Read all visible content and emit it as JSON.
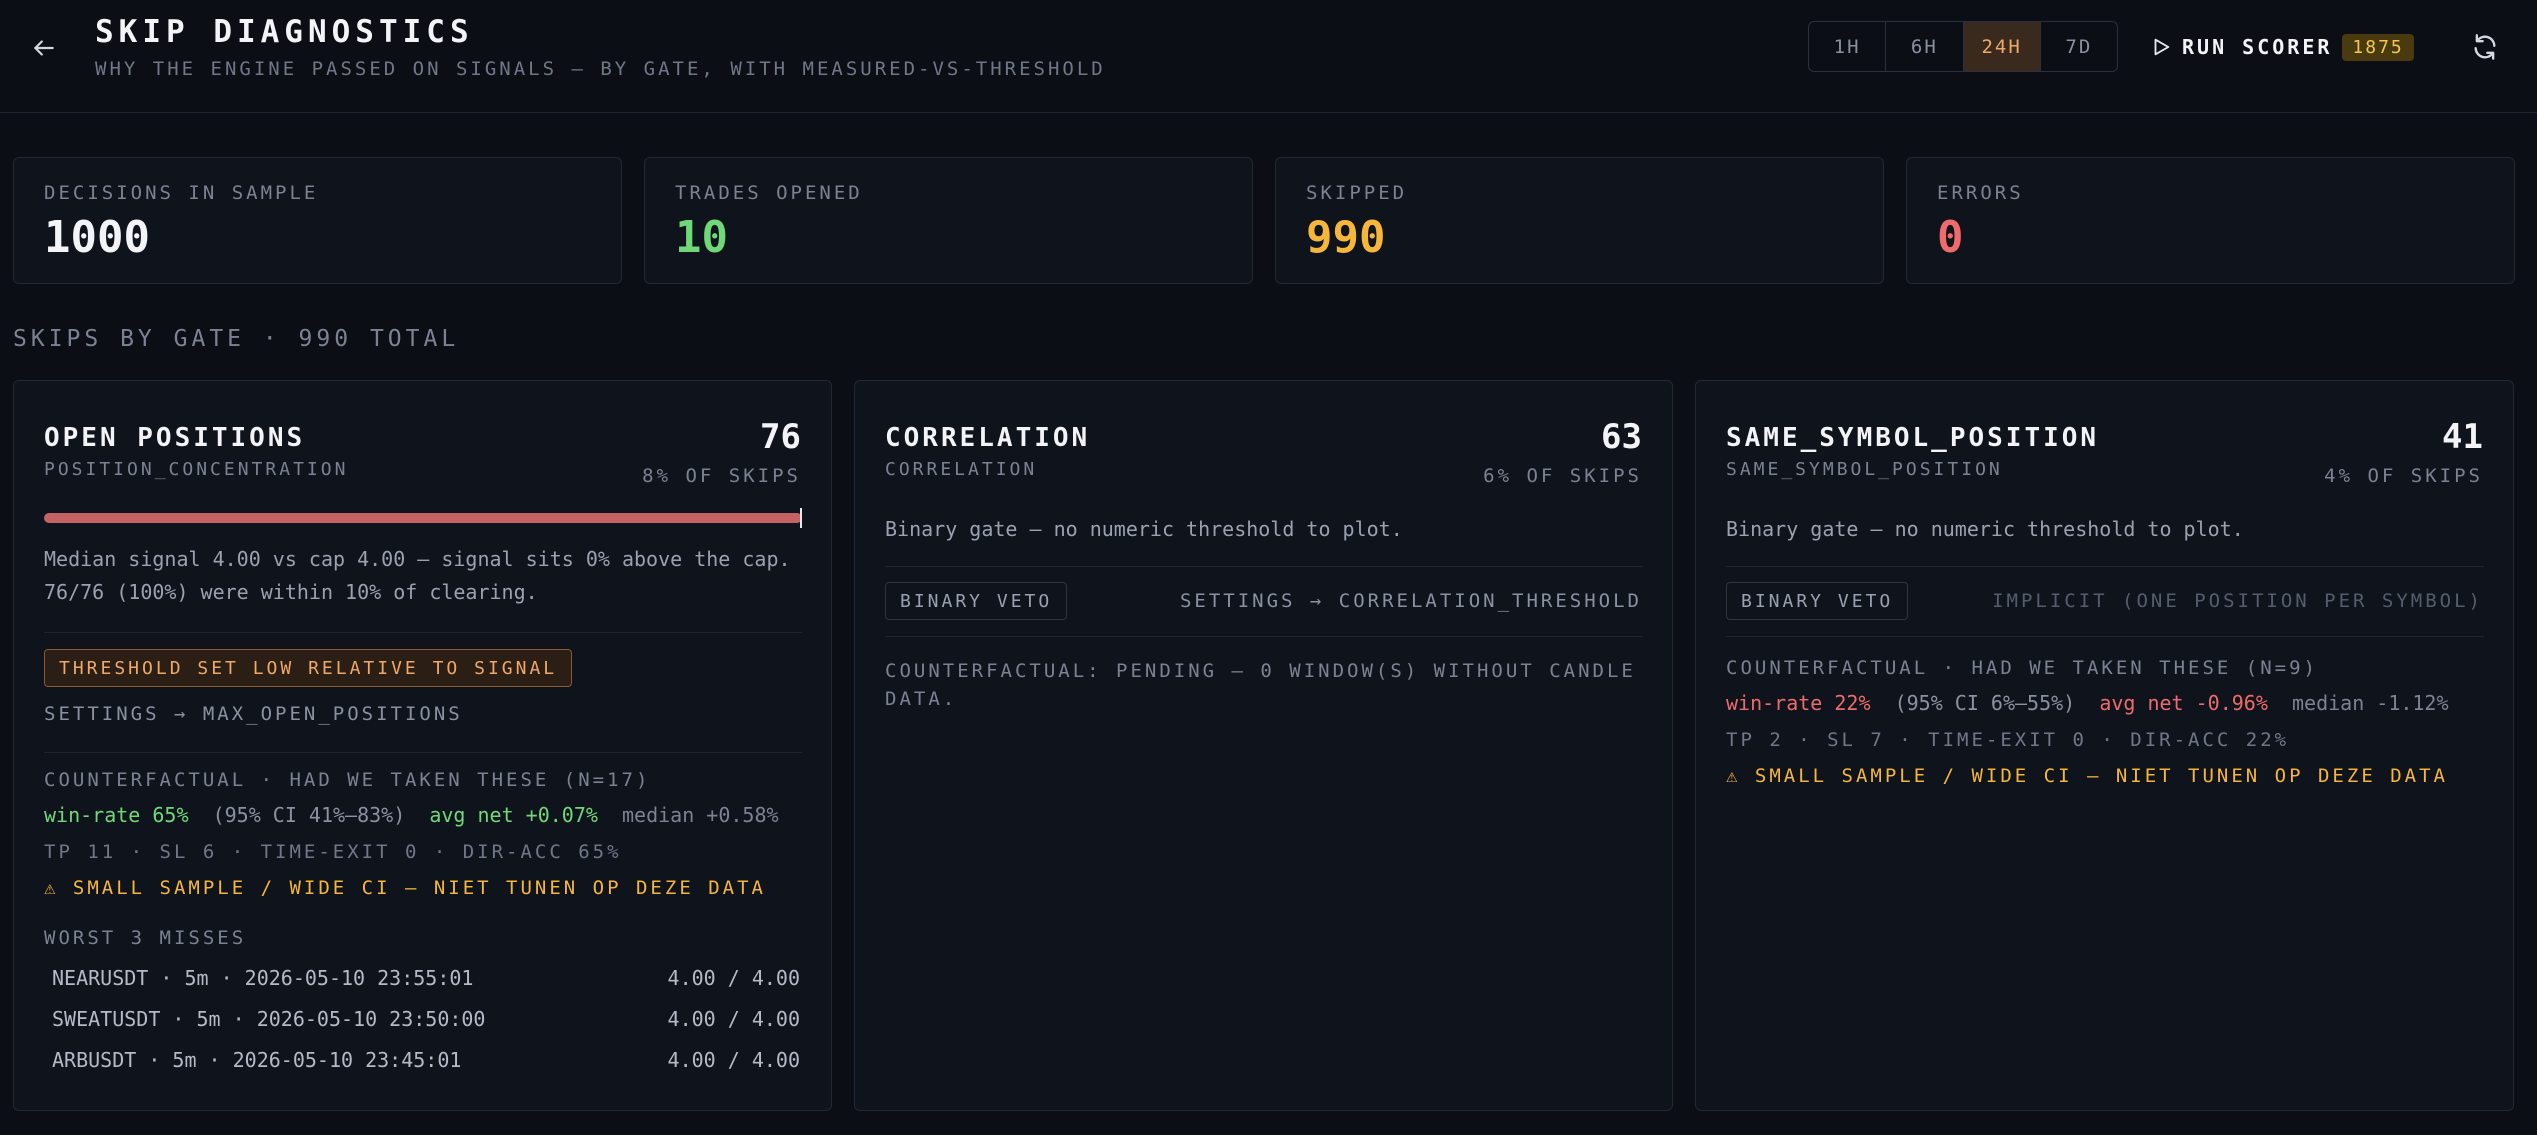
{
  "header": {
    "title": "SKIP DIAGNOSTICS",
    "subtitle": "WHY THE ENGINE PASSED ON SIGNALS — BY GATE, WITH MEASURED-VS-THRESHOLD",
    "ranges": [
      "1H",
      "6H",
      "24H",
      "7D"
    ],
    "active_range": "24H",
    "run_label": "RUN SCORER",
    "run_badge": "1875"
  },
  "stats": [
    {
      "label": "DECISIONS IN SAMPLE",
      "value": "1000",
      "color": "#f3f4f7"
    },
    {
      "label": "TRADES OPENED",
      "value": "10",
      "color": "#6fd97a"
    },
    {
      "label": "SKIPPED",
      "value": "990",
      "color": "#f5b63a"
    },
    {
      "label": "ERRORS",
      "value": "0",
      "color": "#ef6b6b"
    }
  ],
  "section_title": "SKIPS BY GATE · 990 TOTAL",
  "gates": [
    {
      "name": "OPEN POSITIONS",
      "code": "POSITION_CONCENTRATION",
      "count": "76",
      "pct": "8% OF SKIPS",
      "bar_fraction": 1.0,
      "summary": "Median signal 4.00 vs cap 4.00 — signal sits 0% above the cap. 76/76 (100%) were within 10% of clearing.",
      "threshold_badge": "THRESHOLD SET LOW RELATIVE TO SIGNAL",
      "setting": "SETTINGS → MAX_OPEN_POSITIONS",
      "cf_head": "COUNTERFACTUAL · HAD WE TAKEN THESE (N=17)",
      "cf_winrate": "win-rate 65%",
      "cf_ci": "(95% CI 41%–83%)",
      "cf_avg": "avg net +0.07%",
      "cf_median": "median +0.58%",
      "cf_sub": "TP 11 · SL 6 · TIME-EXIT 0 · DIR-ACC 65%",
      "cf_warn": "⚠ SMALL SAMPLE / WIDE CI — NIET TUNEN OP DEZE DATA",
      "miss_head": "WORST 3 MISSES",
      "misses": [
        {
          "label": "NEARUSDT · 5m · 2026-05-10 23:55:01",
          "value": "4.00 / 4.00"
        },
        {
          "label": "SWEATUSDT · 5m · 2026-05-10 23:50:00",
          "value": "4.00 / 4.00"
        },
        {
          "label": "ARBUSDT · 5m · 2026-05-10 23:45:01",
          "value": "4.00 / 4.00"
        }
      ]
    },
    {
      "name": "CORRELATION",
      "code": "CORRELATION",
      "count": "63",
      "pct": "6% OF SKIPS",
      "summary": "Binary gate — no numeric threshold to plot.",
      "veto": "BINARY VETO",
      "setting": "SETTINGS → CORRELATION_THRESHOLD",
      "cf_pending": "COUNTERFACTUAL: PENDING — 0 WINDOW(S) WITHOUT CANDLE DATA."
    },
    {
      "name": "SAME_SYMBOL_POSITION",
      "code": "SAME_SYMBOL_POSITION",
      "count": "41",
      "pct": "4% OF SKIPS",
      "summary": "Binary gate — no numeric threshold to plot.",
      "veto": "BINARY VETO",
      "setting": "IMPLICIT (ONE POSITION PER SYMBOL)",
      "cf_head": "COUNTERFACTUAL · HAD WE TAKEN THESE (N=9)",
      "cf_winrate": "win-rate 22%",
      "cf_ci": "(95% CI 6%–55%)",
      "cf_avg": "avg net -0.96%",
      "cf_median": "median -1.12%",
      "cf_sub": "TP 2 · SL 7 · TIME-EXIT 0 · DIR-ACC 22%",
      "cf_warn": "⚠ SMALL SAMPLE / WIDE CI — NIET TUNEN OP DEZE DATA"
    }
  ]
}
